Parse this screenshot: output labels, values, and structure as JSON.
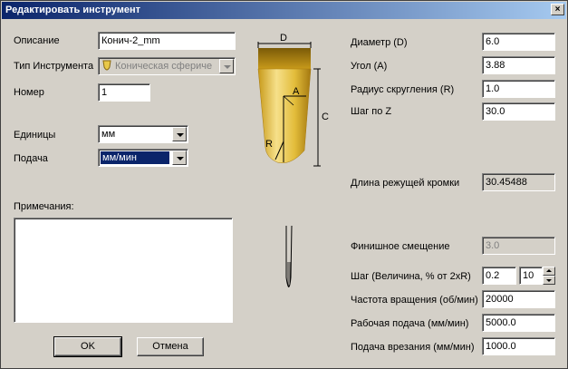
{
  "window": {
    "title": "Редактировать инструмент",
    "close_glyph": "×"
  },
  "left": {
    "description_label": "Описание",
    "description_value": "Конич-2_mm",
    "tool_type_label": "Тип Инструмента",
    "tool_type_value": "Коническая сфериче",
    "number_label": "Номер",
    "number_value": "1",
    "units_label": "Единицы",
    "units_value": "мм",
    "feed_label": "Подача",
    "feed_value": "мм/мин",
    "notes_label": "Примечания:",
    "notes_value": ""
  },
  "diagram": {
    "label_d": "D",
    "label_a": "A",
    "label_r": "R",
    "label_c": "C"
  },
  "params": {
    "diameter_label": "Диаметр (D)",
    "diameter_value": "6.0",
    "angle_label": "Угол (A)",
    "angle_value": "3.88",
    "radius_label": "Радиус скругления (R)",
    "radius_value": "1.0",
    "stepz_label": "Шаг по Z",
    "stepz_value": "30.0",
    "cutting_length_label": "Длина режущей кромки",
    "cutting_length_value": "30.45488",
    "finish_offset_label": "Финишное смещение",
    "finish_offset_value": "3.0",
    "stepover_label": "Шаг (Величина, % от 2xR)",
    "stepover_value": "0.2",
    "stepover_percent": "10",
    "spindle_label": "Частота вращения (об/мин)",
    "spindle_value": "20000",
    "feedrate_label": "Рабочая подача (мм/мин)",
    "feedrate_value": "5000.0",
    "plunge_label": "Подача врезания (мм/мин)",
    "plunge_value": "1000.0"
  },
  "buttons": {
    "ok": "OK",
    "cancel": "Отмена"
  },
  "colors": {
    "tool_gold": "#e8c84a",
    "tool_dark": "#8a6a10"
  }
}
